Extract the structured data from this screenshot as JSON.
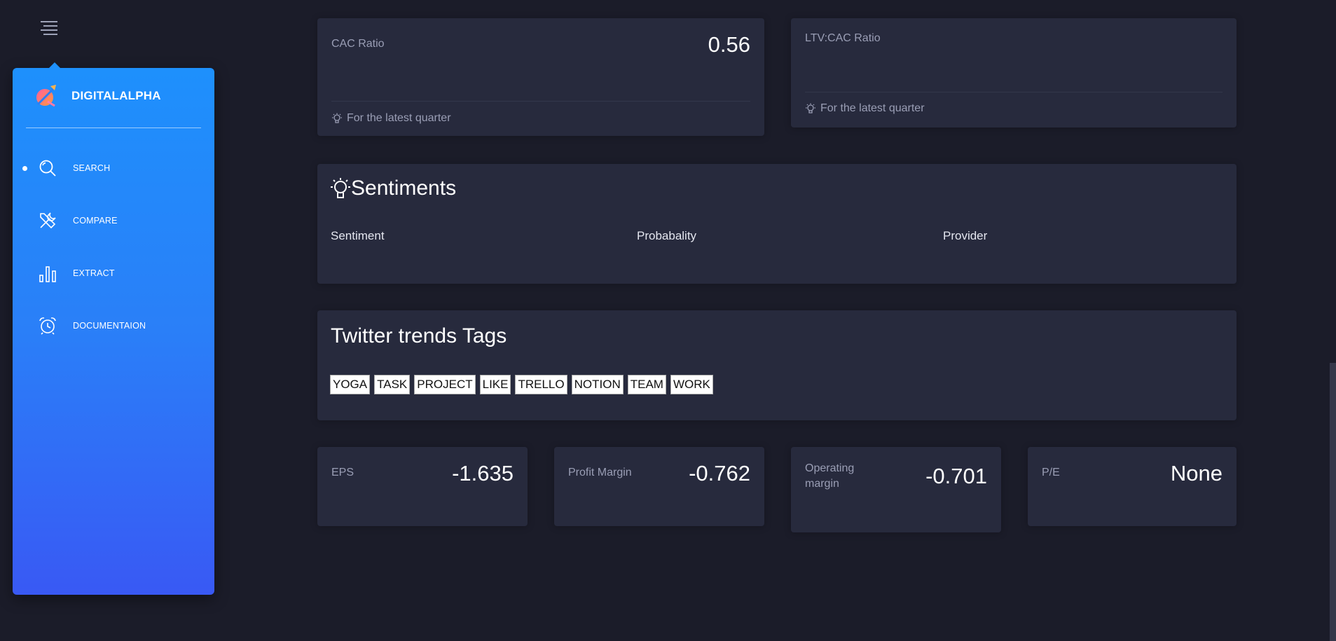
{
  "sidebar": {
    "brand": "DIGITALALPHA",
    "items": [
      {
        "label": "SEARCH",
        "icon": "search-icon",
        "active": true
      },
      {
        "label": "COMPARE",
        "icon": "tools-icon",
        "active": false
      },
      {
        "label": "EXTRACT",
        "icon": "bar-chart-icon",
        "active": false
      },
      {
        "label": "DOCUMENTAION",
        "icon": "alarm-clock-icon",
        "active": false
      }
    ]
  },
  "cac": {
    "title": "CAC Ratio",
    "value": "0.56",
    "footer": "For the latest quarter"
  },
  "ltv": {
    "title": "LTV:CAC Ratio",
    "value": "",
    "footer": "For the latest quarter"
  },
  "sentiments": {
    "title": "Sentiments",
    "columns": [
      "Sentiment",
      "Probabality",
      "Provider"
    ]
  },
  "twitter": {
    "title": "Twitter trends Tags",
    "tags": [
      "YOGA",
      "TASK",
      "PROJECT",
      "LIKE",
      "TRELLO",
      "NOTION",
      "TEAM",
      "WORK"
    ]
  },
  "metrics": [
    {
      "title": "EPS",
      "value": "-1.635"
    },
    {
      "title": "Profit Margin",
      "value": "-0.762"
    },
    {
      "title": "Operating margin",
      "value": "-0.701"
    },
    {
      "title": "P/E",
      "value": "None"
    }
  ],
  "colors": {
    "background": "#1b1c29",
    "card": "#272a3d",
    "sidebar_top": "#1e90fc",
    "sidebar_bottom": "#3959f4",
    "muted_text": "#9a9eb5"
  }
}
